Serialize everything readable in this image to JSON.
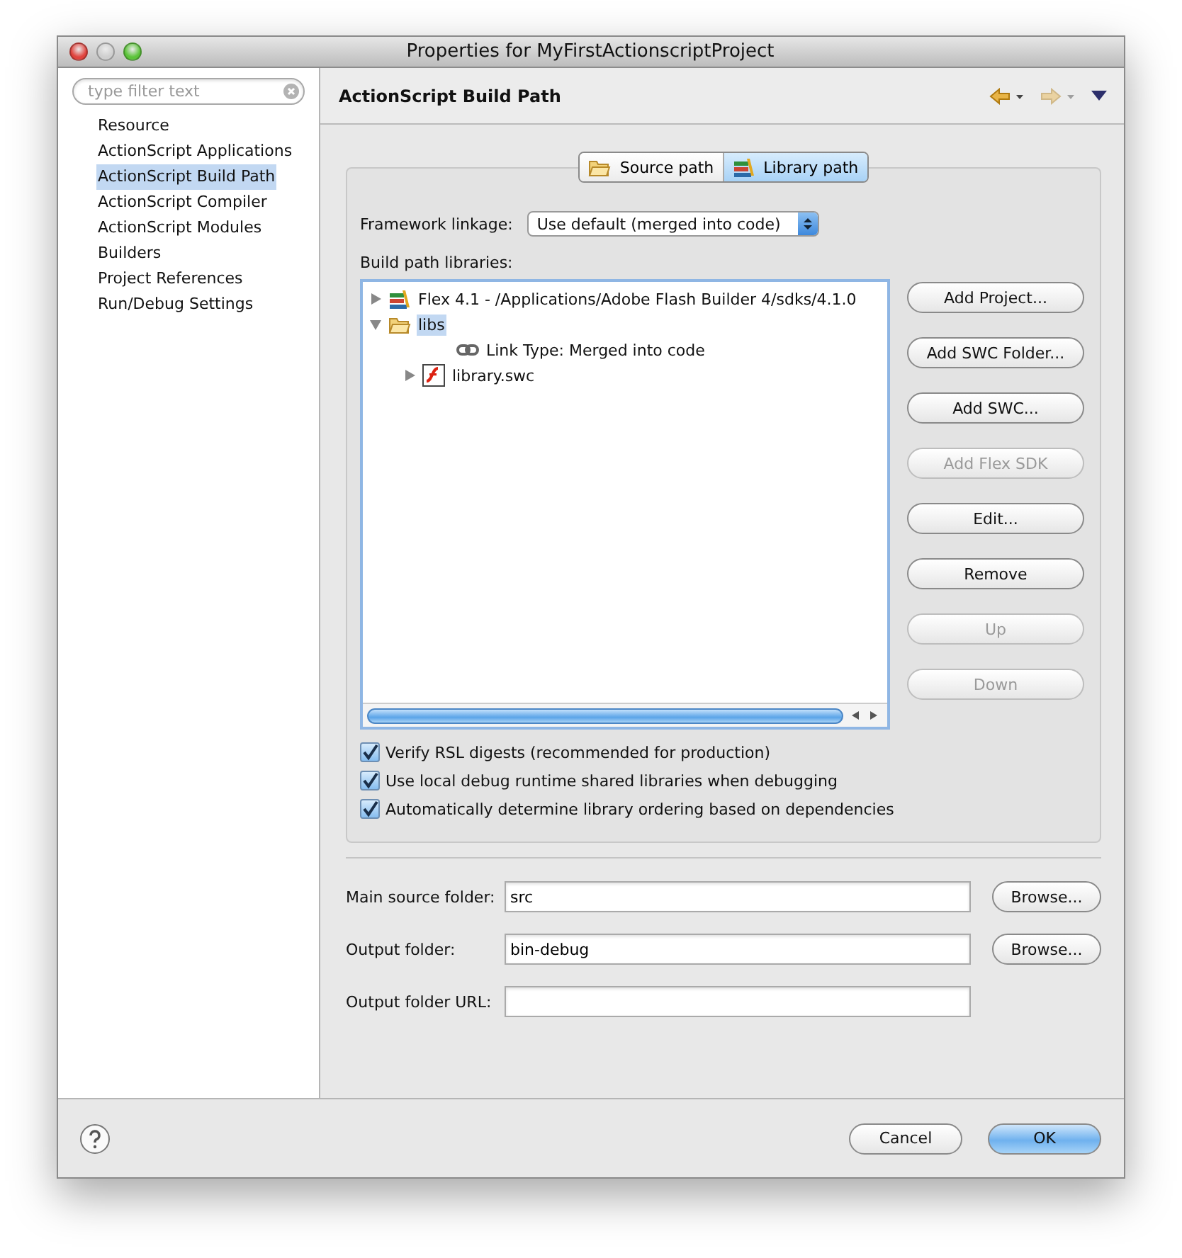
{
  "window": {
    "title": "Properties for MyFirstActionscriptProject"
  },
  "filter": {
    "placeholder": "type filter text"
  },
  "sidebar": {
    "items": [
      {
        "label": "Resource",
        "selected": false
      },
      {
        "label": "ActionScript Applications",
        "selected": false
      },
      {
        "label": "ActionScript Build Path",
        "selected": true
      },
      {
        "label": "ActionScript Compiler",
        "selected": false
      },
      {
        "label": "ActionScript Modules",
        "selected": false
      },
      {
        "label": "Builders",
        "selected": false
      },
      {
        "label": "Project References",
        "selected": false
      },
      {
        "label": "Run/Debug Settings",
        "selected": false
      }
    ]
  },
  "page": {
    "title": "ActionScript Build Path"
  },
  "nav": [
    {
      "kind": "back",
      "disabled": false
    },
    {
      "kind": "forward",
      "disabled": true
    },
    {
      "kind": "menu"
    }
  ],
  "tabs": [
    {
      "label": "Source path",
      "kind": "source",
      "selected": false
    },
    {
      "label": "Library path",
      "kind": "library",
      "selected": true
    }
  ],
  "linkage": {
    "label": "Framework linkage:",
    "value": "Use default (merged into code)"
  },
  "libraries": {
    "label": "Build path libraries:",
    "tree": [
      {
        "label": "Flex 4.1 - /Applications/Adobe Flash Builder 4/sdks/4.1.0",
        "kind": "sdk",
        "expanded": false,
        "selected": false
      },
      {
        "label": "libs",
        "kind": "folder",
        "expanded": true,
        "selected": true,
        "children": [
          {
            "label": "Link Type: Merged into code",
            "kind": "link",
            "selected": false
          },
          {
            "label": "library.swc",
            "kind": "swc",
            "expanded": false,
            "selected": false
          }
        ]
      }
    ]
  },
  "buttons": [
    {
      "label": "Add Project...",
      "disabled": false
    },
    {
      "label": "Add SWC Folder...",
      "disabled": false
    },
    {
      "label": "Add SWC...",
      "disabled": false
    },
    {
      "label": "Add Flex SDK",
      "disabled": true
    },
    {
      "label": "Edit...",
      "disabled": false
    },
    {
      "label": "Remove",
      "disabled": false
    },
    {
      "label": "Up",
      "disabled": true
    },
    {
      "label": "Down",
      "disabled": true
    }
  ],
  "checkboxes": [
    {
      "label": "Verify RSL digests (recommended for production)",
      "checked": true
    },
    {
      "label": "Use local debug runtime shared libraries when debugging",
      "checked": true
    },
    {
      "label": "Automatically determine library ordering based on dependencies",
      "checked": true
    }
  ],
  "fields": [
    {
      "label": "Main source folder:",
      "value": "src",
      "button": "Browse..."
    },
    {
      "label": "Output folder:",
      "value": "bin-debug",
      "button": "Browse..."
    },
    {
      "label": "Output folder URL:"
    }
  ],
  "footer": {
    "buttons": [
      {
        "label": "Cancel",
        "kind": "normal"
      },
      {
        "label": "OK",
        "kind": "default"
      }
    ]
  }
}
